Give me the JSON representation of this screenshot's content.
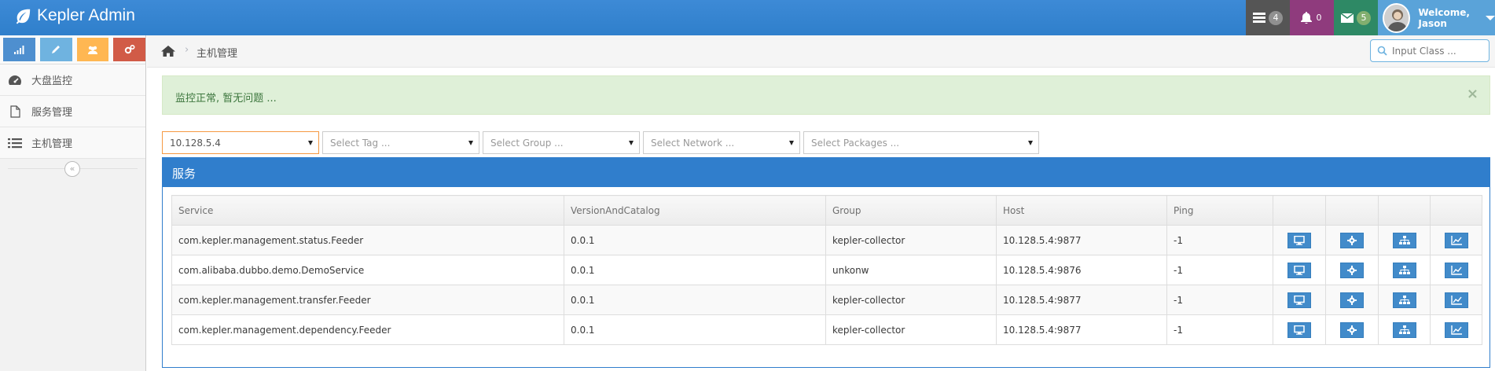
{
  "app": {
    "title": "Kepler Admin"
  },
  "navbar": {
    "tasks_count": "4",
    "notifications_count": "0",
    "messages_count": "5",
    "welcome": "Welcome,",
    "user_name": "Jason"
  },
  "sidebar": {
    "items": [
      {
        "label": "大盘监控",
        "icon": "dashboard-icon"
      },
      {
        "label": "服务管理",
        "icon": "file-icon"
      },
      {
        "label": "主机管理",
        "icon": "list-icon"
      }
    ],
    "collapse_label": "«"
  },
  "breadcrumb": {
    "separator": "›",
    "current": "主机管理"
  },
  "search": {
    "placeholder": "Input Class ..."
  },
  "alert": {
    "message": "监控正常, 暂无问题 ...",
    "close": "×"
  },
  "filters": {
    "host": "10.128.5.4",
    "tag": "Select Tag ...",
    "group": "Select Group ...",
    "network": "Select Network ...",
    "packages": "Select Packages ..."
  },
  "panel": {
    "title": "服务"
  },
  "table": {
    "headers": [
      "Service",
      "VersionAndCatalog",
      "Group",
      "Host",
      "Ping"
    ],
    "rows": [
      {
        "service": "com.kepler.management.status.Feeder",
        "version": "0.0.1",
        "group": "kepler-collector",
        "host": "10.128.5.4:9877",
        "ping": "-1"
      },
      {
        "service": "com.alibaba.dubbo.demo.DemoService",
        "version": "0.0.1",
        "group": "unkonw",
        "host": "10.128.5.4:9876",
        "ping": "-1"
      },
      {
        "service": "com.kepler.management.transfer.Feeder",
        "version": "0.0.1",
        "group": "kepler-collector",
        "host": "10.128.5.4:9877",
        "ping": "-1"
      },
      {
        "service": "com.kepler.management.dependency.Feeder",
        "version": "0.0.1",
        "group": "kepler-collector",
        "host": "10.128.5.4:9877",
        "ping": "-1"
      }
    ],
    "row_actions": [
      "desktop-icon",
      "gear-icon",
      "sitemap-icon",
      "chart-icon"
    ]
  },
  "colors": {
    "navbar": "#3a87d4",
    "primary": "#307ecc",
    "action_button": "#428bca",
    "alert_bg": "#dff0d8",
    "alert_text": "#3c763d"
  }
}
